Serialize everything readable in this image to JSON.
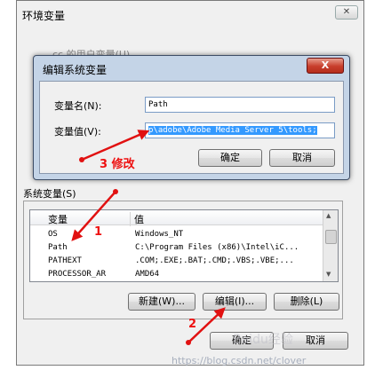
{
  "outer": {
    "title": "环境变量",
    "close_glyph": "✕",
    "user_vars_label_partial": "cc 的用户变量(U)",
    "system_vars_label": "系统变量(S)",
    "columns": [
      "变量",
      "值"
    ],
    "rows": [
      {
        "name": "OS",
        "value": "Windows_NT"
      },
      {
        "name": "Path",
        "value": "C:\\Program Files (x86)\\Intel\\iC..."
      },
      {
        "name": "PATHEXT",
        "value": ".COM;.EXE;.BAT;.CMD;.VBS;.VBE;..."
      },
      {
        "name": "PROCESSOR_AR",
        "value": "AMD64"
      }
    ],
    "buttons": {
      "new": "新建(W)...",
      "edit": "编辑(I)...",
      "delete": "删除(L)",
      "ok": "确定",
      "cancel": "取消"
    }
  },
  "inner": {
    "title": "编辑系统变量",
    "close_glyph": "X",
    "var_name_label": "变量名(N):",
    "var_name_value": "Path",
    "var_value_label": "变量值(V):",
    "var_value_value": "p\\adobe\\Adobe Media Server 5\\tools;",
    "buttons": {
      "ok": "确定",
      "cancel": "取消"
    }
  },
  "annotations": {
    "step1": "1",
    "step2": "2",
    "step3": "3  修改",
    "color": "#e11111"
  },
  "watermark": {
    "url": "https://blog.csdn.net/clover",
    "brand": "Baidu经验"
  },
  "colors": {
    "selection": "#3399ff",
    "dialog_frame": "#c4d4e7",
    "close_red": "#c73d2b"
  }
}
